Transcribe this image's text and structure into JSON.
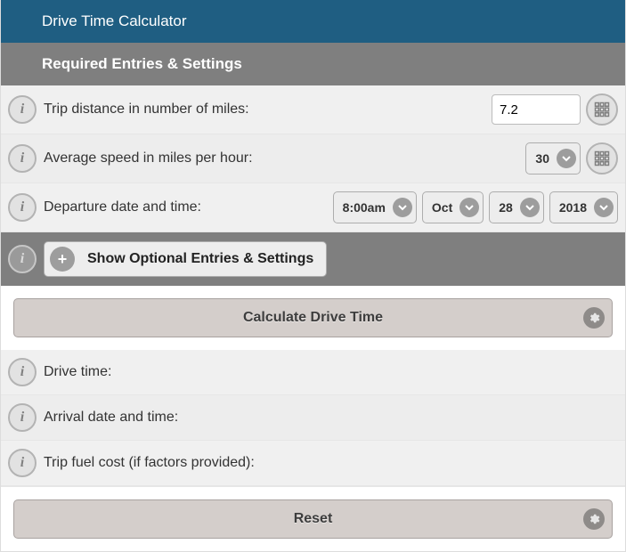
{
  "header": {
    "title": "Drive Time Calculator"
  },
  "subheader": {
    "title": "Required Entries & Settings"
  },
  "rows": {
    "distance": {
      "label": "Trip distance in number of miles:",
      "value": "7.2"
    },
    "speed": {
      "label": "Average speed in miles per hour:",
      "selected": "30"
    },
    "departure": {
      "label": "Departure date and time:",
      "time": "8:00am",
      "month": "Oct",
      "day": "28",
      "year": "2018"
    }
  },
  "optional": {
    "button_label": "Show Optional Entries & Settings"
  },
  "actions": {
    "calculate": "Calculate Drive Time",
    "reset": "Reset"
  },
  "results": {
    "drive_time": {
      "label": "Drive time:"
    },
    "arrival": {
      "label": "Arrival date and time:"
    },
    "fuel": {
      "label": "Trip fuel cost (if factors provided):"
    }
  }
}
